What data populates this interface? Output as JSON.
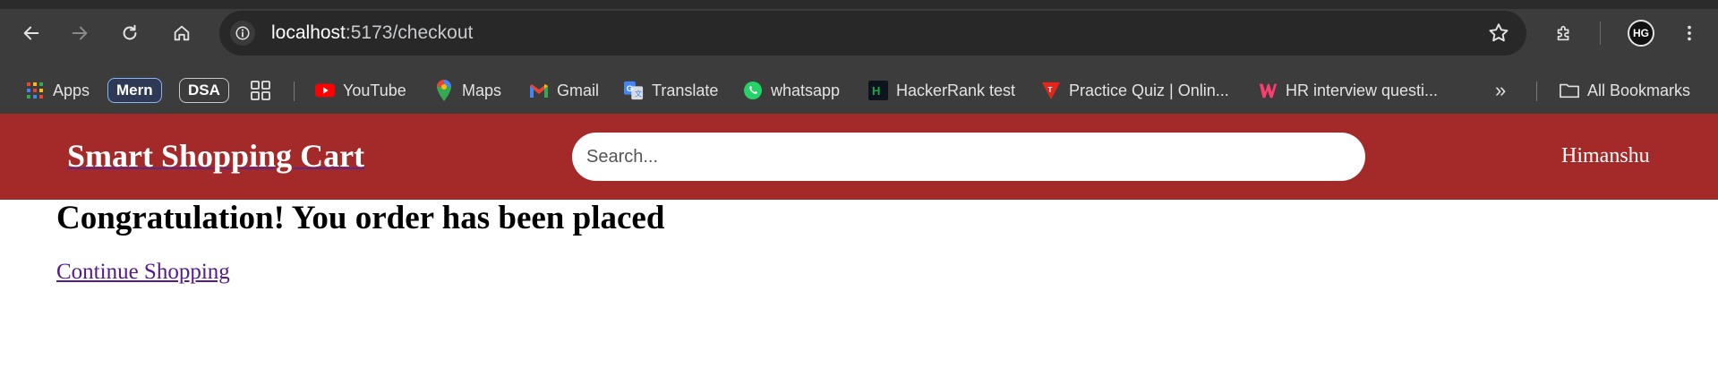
{
  "browser": {
    "url_host": "localhost",
    "url_path": ":5173/checkout",
    "profile_initials": "HG",
    "bookmarks": [
      {
        "label": "Apps",
        "icon": "apps-grid-icon"
      },
      {
        "label": "Mern",
        "icon": "chip"
      },
      {
        "label": "DSA",
        "icon": "chip"
      },
      {
        "label": "",
        "icon": "tab-groups-icon"
      },
      {
        "label": "YouTube",
        "icon": "youtube-icon"
      },
      {
        "label": "Maps",
        "icon": "maps-pin-icon"
      },
      {
        "label": "Gmail",
        "icon": "gmail-icon"
      },
      {
        "label": "Translate",
        "icon": "translate-icon"
      },
      {
        "label": "whatsapp",
        "icon": "whatsapp-icon"
      },
      {
        "label": "HackerRank test",
        "icon": "hackerrank-icon"
      },
      {
        "label": "Practice Quiz | Onlin...",
        "icon": "quiz-icon"
      },
      {
        "label": "HR interview questi...",
        "icon": "w-icon"
      }
    ],
    "all_bookmarks_label": "All Bookmarks"
  },
  "app": {
    "brand": "Smart Shopping Cart",
    "search_placeholder": "Search...",
    "user_name": "Himanshu",
    "header_color": "#a42a2a"
  },
  "page": {
    "headline": "Congratulation! You order has been placed",
    "continue_link": "Continue Shopping"
  }
}
